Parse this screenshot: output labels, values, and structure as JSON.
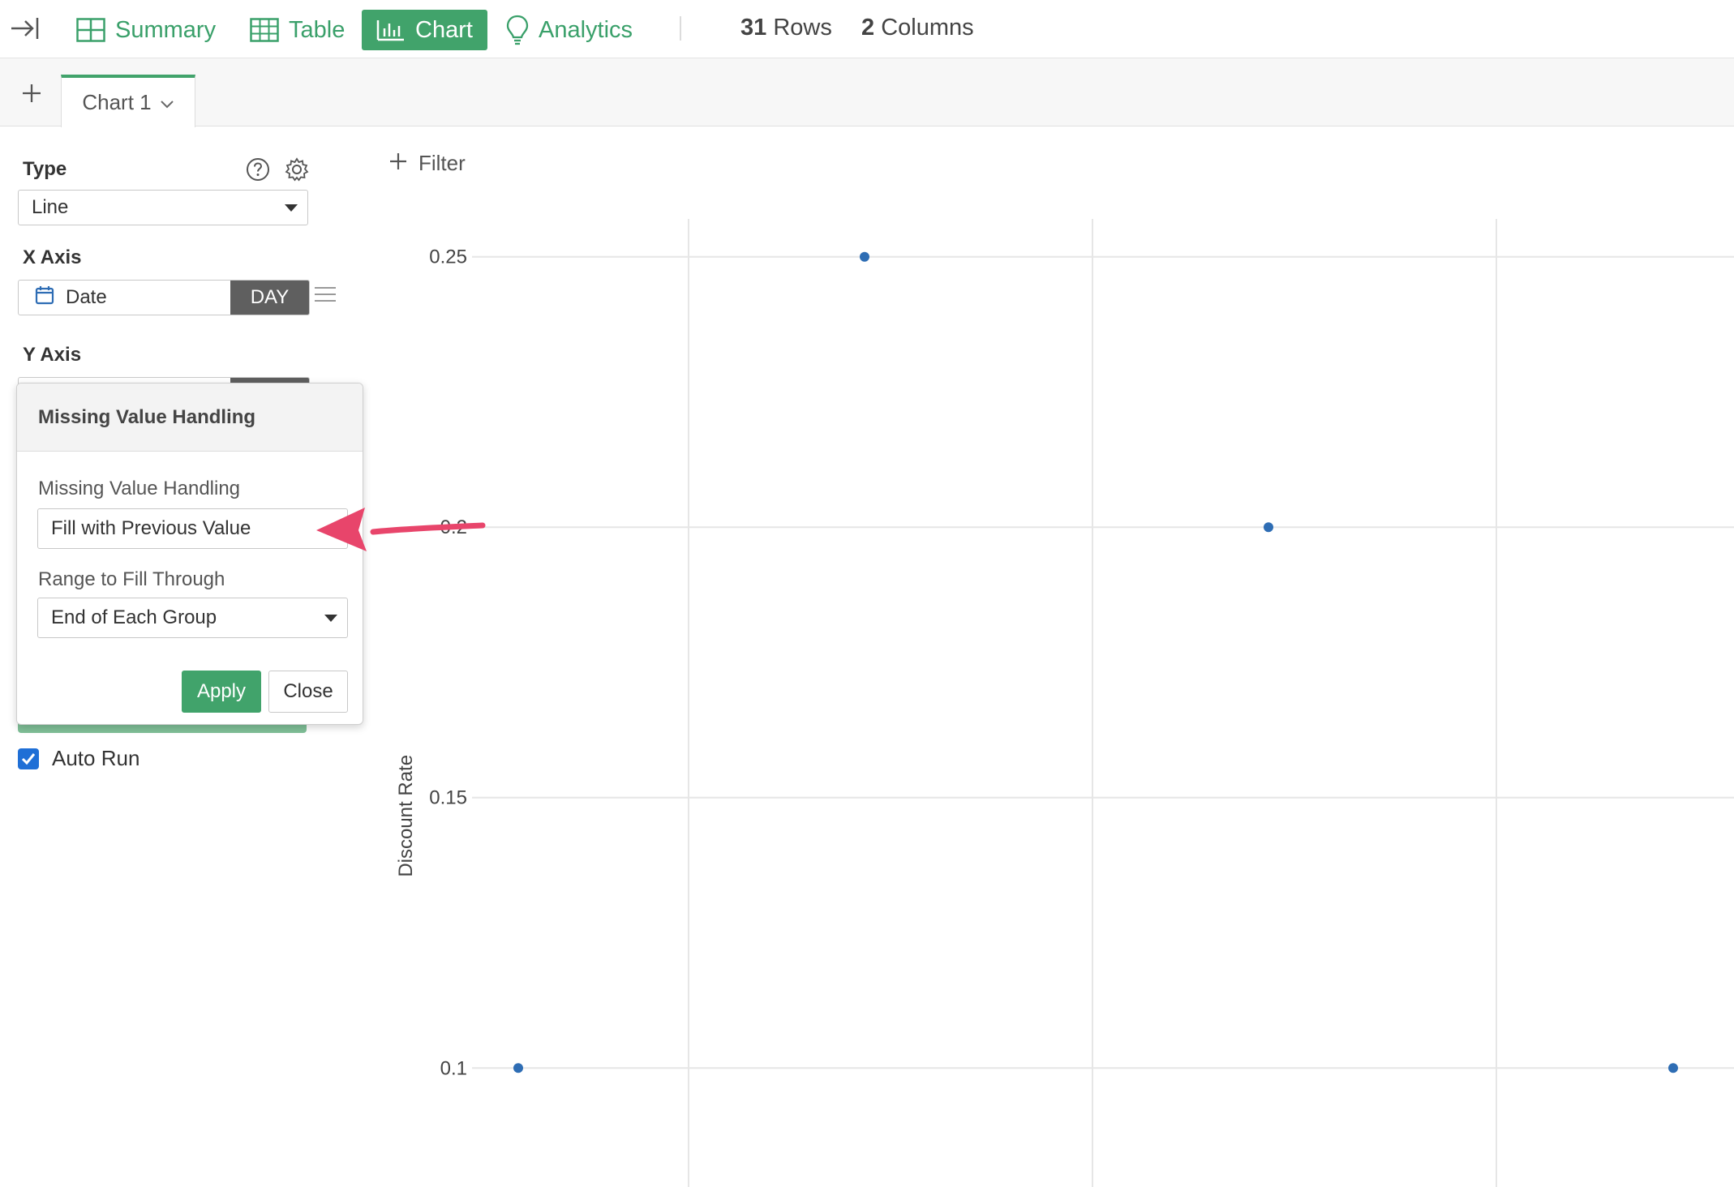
{
  "topbar": {
    "tabs": [
      {
        "label": "Summary",
        "icon": "summary-grid-icon"
      },
      {
        "label": "Table",
        "icon": "table-icon"
      },
      {
        "label": "Chart",
        "icon": "bar-chart-icon"
      },
      {
        "label": "Analytics",
        "icon": "lightbulb-icon"
      }
    ],
    "active_tab": "Chart",
    "rows_count": "31",
    "rows_label": "Rows",
    "columns_count": "2",
    "columns_label": "Columns"
  },
  "chart_tabs": {
    "current": "Chart 1"
  },
  "sidebar": {
    "type_label": "Type",
    "type_value": "Line",
    "x_axis_label": "X Axis",
    "x_axis_field": "Date",
    "x_axis_unit": "DAY",
    "y_axis_label": "Y Axis",
    "auto_run_label": "Auto Run",
    "auto_run_checked": true
  },
  "popover": {
    "title": "Missing Value Handling",
    "field1_label": "Missing Value Handling",
    "field1_value": "Fill with Previous Value",
    "field2_label": "Range to Fill Through",
    "field2_value": "End of Each Group",
    "apply_label": "Apply",
    "close_label": "Close"
  },
  "filter": {
    "label": "Filter"
  },
  "colors": {
    "accent": "#41a36b",
    "point": "#2e6db4",
    "arrow": "#e8456b"
  },
  "chart_data": {
    "type": "line",
    "ylabel": "Discount Rate",
    "yticks": [
      "0.25",
      "0.2",
      "0.15",
      "0.1"
    ],
    "points": [
      {
        "x": 0.05,
        "y": 0.1
      },
      {
        "x": 0.35,
        "y": 0.25
      },
      {
        "x": 0.7,
        "y": 0.2
      },
      {
        "x": 1.05,
        "y": 0.1
      }
    ],
    "ylim": [
      0.078,
      0.26
    ],
    "grid": true
  }
}
